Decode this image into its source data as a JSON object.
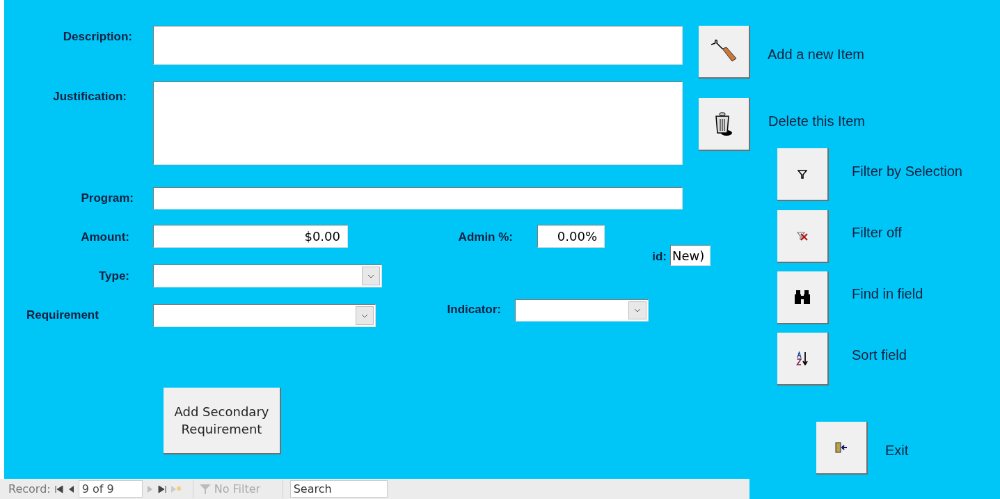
{
  "fields": [
    {
      "kind": "text",
      "label": "Description:"
    },
    {
      "kind": "memo",
      "label": "Justification:"
    },
    {
      "kind": "text",
      "label": "Program:"
    },
    {
      "kind": "text",
      "label": "Amount:",
      "value": "$0.00"
    },
    {
      "kind": "text",
      "label": "Admin %:",
      "value": "0.00%"
    },
    {
      "kind": "text",
      "label": "id:",
      "value": "New)"
    },
    {
      "kind": "combo",
      "label": "Type:"
    },
    {
      "kind": "combo",
      "label": "Requirement"
    },
    {
      "kind": "combo",
      "label": "Indicator:"
    }
  ],
  "secondary_button": "Add Secondary Requirement",
  "actions": [
    {
      "kind": "pencil",
      "label": "Add a new Item"
    },
    {
      "kind": "trash",
      "label": "Delete this Item"
    },
    {
      "kind": "filter",
      "label": "Filter by Selection"
    },
    {
      "kind": "filter-off",
      "label": "Filter off"
    },
    {
      "kind": "binoculars",
      "label": "Find in field"
    },
    {
      "kind": "sort",
      "label": "Sort field"
    },
    {
      "kind": "exit",
      "label": "Exit"
    }
  ],
  "navigation": {
    "label": "Record:",
    "record": "9 of 9",
    "filter": "No Filter",
    "search": {
      "placeholder": "Search"
    }
  }
}
